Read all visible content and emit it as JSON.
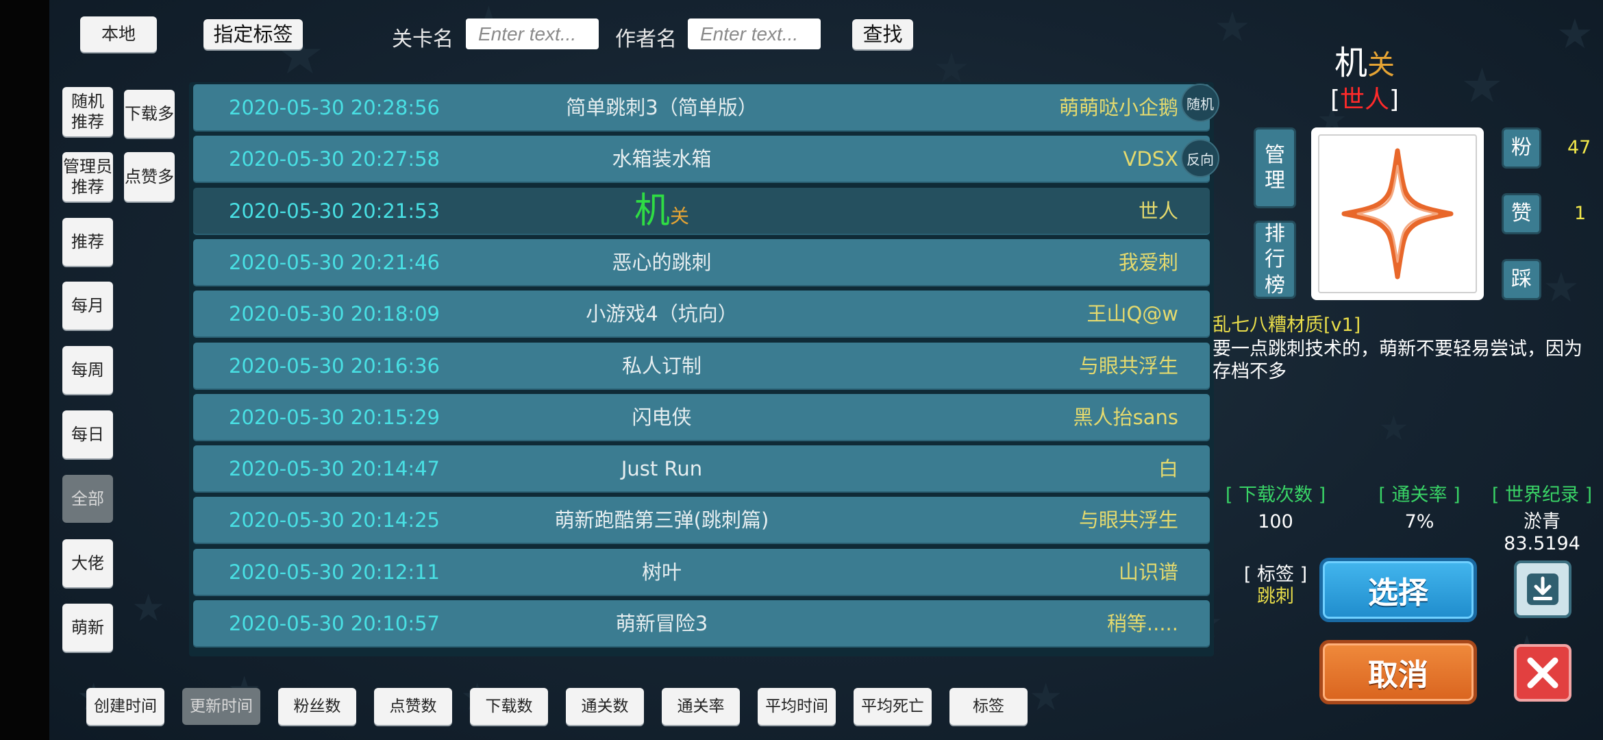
{
  "colors": {
    "date": "#49e0e4",
    "author": "#e5da6e",
    "stat_header": "#39d466",
    "desc_title": "#e9dd4a",
    "red_name": "#ff2a2a",
    "select_blue": "#2a9fdc",
    "cancel_orange": "#e6742c",
    "close_red": "#e24040"
  },
  "top_bar": {
    "local_button": "本地",
    "tag_button": "指定标签",
    "level_name_label": "关卡名",
    "level_name_placeholder": "Enter text...",
    "author_label": "作者名",
    "author_placeholder": "Enter text...",
    "search_button": "查找"
  },
  "left_menu": {
    "random_recommend": "随机\n推荐",
    "most_downloads": "下载多",
    "admin_recommend": "管理员\n推荐",
    "most_likes": "点赞多",
    "recommend": "推荐",
    "monthly": "每月",
    "weekly": "每周",
    "daily": "每日",
    "all": "全部",
    "experts": "大佬",
    "newbies": "萌新"
  },
  "side_buttons": {
    "random": "随机",
    "reverse": "反向"
  },
  "levels": [
    {
      "date": "2020-05-30 20:28:56",
      "title": "简单跳刺3（简单版）",
      "author": "萌萌哒小企鹅"
    },
    {
      "date": "2020-05-30 20:27:58",
      "title": "水箱装水箱",
      "author": "VDSX"
    },
    {
      "date": "2020-05-30 20:21:53",
      "title_a": "机",
      "title_b": "关",
      "author": "世人"
    },
    {
      "date": "2020-05-30 20:21:46",
      "title": "恶心的跳刺",
      "author": "我爱刺"
    },
    {
      "date": "2020-05-30 20:18:09",
      "title": "小游戏4（坑向）",
      "author": "王山Q@w"
    },
    {
      "date": "2020-05-30 20:16:36",
      "title": "私人订制",
      "author": "与眼共浮生"
    },
    {
      "date": "2020-05-30 20:15:29",
      "title": "闪电侠",
      "author": "黑人抬sans"
    },
    {
      "date": "2020-05-30 20:14:47",
      "title": "Just Run",
      "author": "白"
    },
    {
      "date": "2020-05-30 20:14:25",
      "title": "萌新跑酷第三弹(跳刺篇)",
      "author": "与眼共浮生"
    },
    {
      "date": "2020-05-30 20:12:11",
      "title": "树叶",
      "author": "山识谱"
    },
    {
      "date": "2020-05-30 20:10:57",
      "title": "萌新冒险3",
      "author": "稍等....."
    }
  ],
  "sort_bar": [
    "创建时间",
    "更新时间",
    "粉丝数",
    "点赞数",
    "下载数",
    "通关数",
    "通关率",
    "平均时间",
    "平均死亡",
    "标签"
  ],
  "detail": {
    "title_a": "机",
    "title_b": "关",
    "author_open": "[",
    "author": "世人",
    "author_close": "]",
    "manage_button": "管\n理",
    "ranking_button": "排\n行\n榜",
    "fans_label": "粉",
    "fans_count": "47",
    "like_label": "赞",
    "like_count": "1",
    "dislike_label": "踩",
    "desc_title": "乱七八糟材质[v1]",
    "desc_body": "要一点跳刺技术的，萌新不要轻易尝试，因为存档不多",
    "downloads_header": "[ 下载次数 ]",
    "downloads_value": "100",
    "clear_rate_header": "[ 通关率 ]",
    "clear_rate_value": "7%",
    "world_record_header": "[ 世界纪录 ]",
    "world_record_holder": "淤青",
    "world_record_time": "83.5194",
    "tag_header": "[ 标签 ]",
    "tag_value": "跳刺",
    "select_button": "选择",
    "cancel_button": "取消"
  }
}
